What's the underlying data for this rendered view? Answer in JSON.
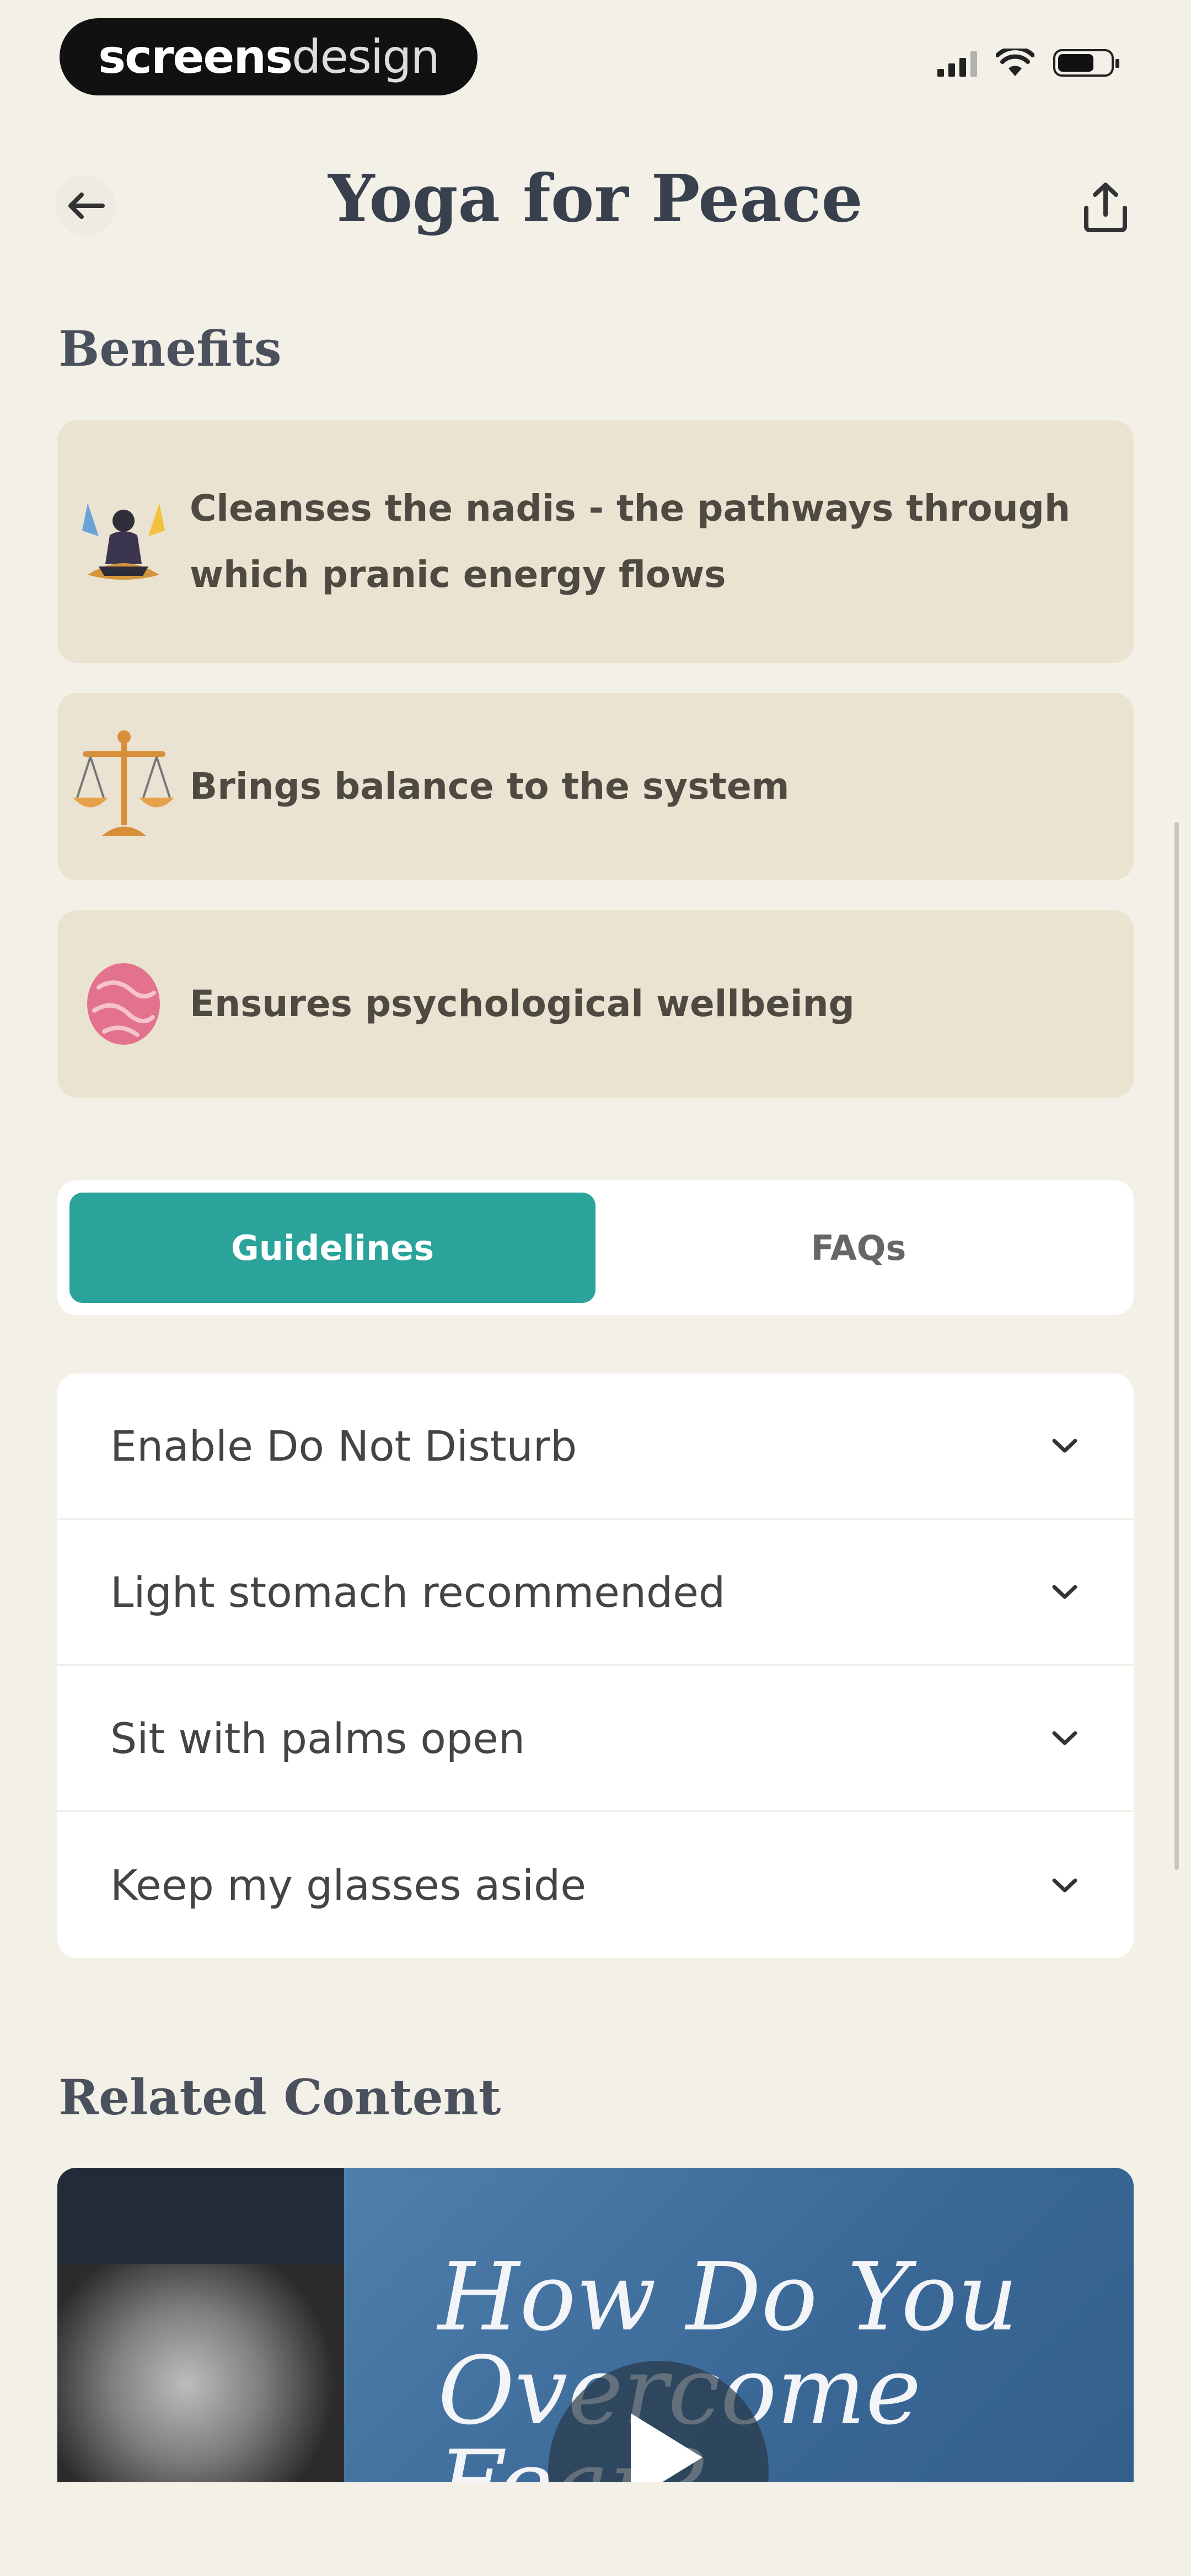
{
  "watermark": {
    "bold": "screens",
    "light": "design"
  },
  "header": {
    "title": "Yoga for Peace"
  },
  "benefits": {
    "heading": "Benefits",
    "items": [
      {
        "line1": "Cleanses the nadis - the pathways through",
        "line2": "which pranic energy flows",
        "icon": "meditation-icon"
      },
      {
        "line1": "Brings balance to the system",
        "icon": "scales-icon"
      },
      {
        "line1": "Ensures psychological wellbeing",
        "icon": "brain-icon"
      }
    ]
  },
  "tabs": {
    "guidelines": "Guidelines",
    "faqs": "FAQs",
    "active": "Guidelines"
  },
  "guidelines": [
    {
      "label": "Enable Do Not Disturb"
    },
    {
      "label": "Light stomach recommended"
    },
    {
      "label": "Sit with palms open"
    },
    {
      "label": "Keep my glasses aside"
    }
  ],
  "related": {
    "heading": "Related Content",
    "card_line1": "How Do You",
    "card_line2": "Overcome Fear?"
  },
  "colors": {
    "accent": "#2aa39a",
    "background": "#f3f0e7",
    "card": "#ebe3d1"
  }
}
